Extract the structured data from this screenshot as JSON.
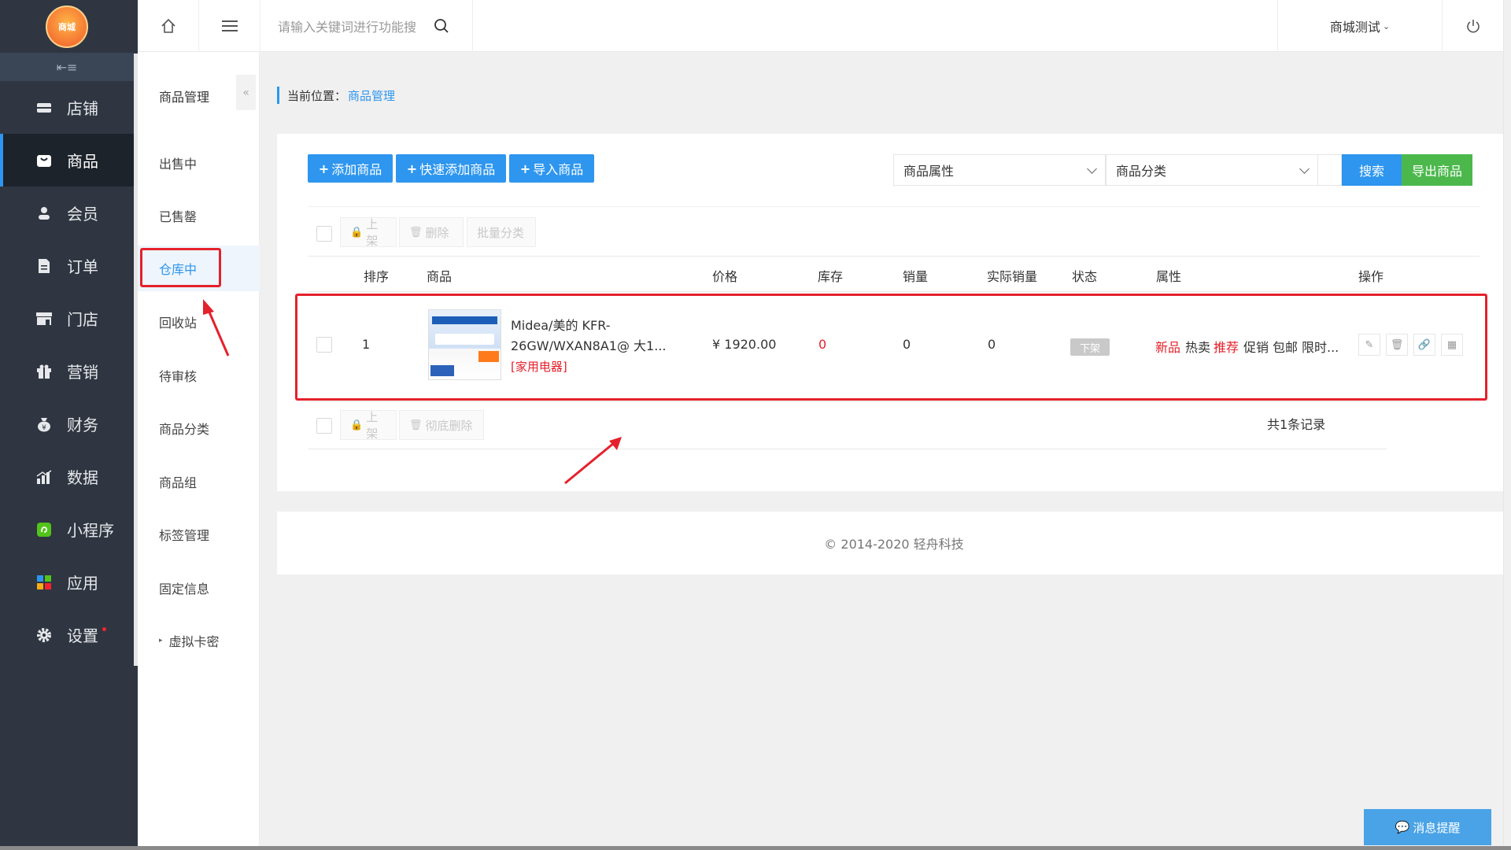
{
  "logo": {
    "label": "商城"
  },
  "sidebar": {
    "items": [
      {
        "label": "店铺",
        "icon": "store-icon"
      },
      {
        "label": "商品",
        "icon": "goods-icon",
        "active": true
      },
      {
        "label": "会员",
        "icon": "member-icon"
      },
      {
        "label": "订单",
        "icon": "order-icon"
      },
      {
        "label": "门店",
        "icon": "shop-icon"
      },
      {
        "label": "营销",
        "icon": "gift-icon"
      },
      {
        "label": "财务",
        "icon": "money-bag-icon"
      },
      {
        "label": "数据",
        "icon": "chart-icon"
      },
      {
        "label": "小程序",
        "icon": "miniprogram-icon"
      },
      {
        "label": "应用",
        "icon": "apps-icon"
      },
      {
        "label": "设置",
        "icon": "gear-icon"
      }
    ]
  },
  "subnav": {
    "title": "商品管理",
    "items": [
      {
        "label": "出售中"
      },
      {
        "label": "已售罄"
      },
      {
        "label": "仓库中",
        "active": true
      },
      {
        "label": "回收站"
      },
      {
        "label": "待审核"
      },
      {
        "label": "商品分类"
      },
      {
        "label": "商品组"
      },
      {
        "label": "标签管理"
      },
      {
        "label": "固定信息"
      },
      {
        "label": "虚拟卡密"
      }
    ]
  },
  "topbar": {
    "search_placeholder": "请输入关键词进行功能搜",
    "store_name": "商城测试"
  },
  "breadcrumb": {
    "prefix": "当前位置：",
    "current": "商品管理"
  },
  "toolbar": {
    "add": "添加商品",
    "quick_add": "快速添加商品",
    "import": "导入商品",
    "attr_select": "商品属性",
    "category_select": "商品分类",
    "search": "搜索",
    "export": "导出商品"
  },
  "bulk": {
    "shelf_on": "上架",
    "delete": "删除",
    "batch_category": "批量分类",
    "delete_perm": "彻底删除"
  },
  "table": {
    "headers": [
      "排序",
      "商品",
      "价格",
      "库存",
      "销量",
      "实际销量",
      "状态",
      "属性",
      "操作"
    ],
    "rows": [
      {
        "sort": "1",
        "name_line1": "Midea/美的 KFR-",
        "name_line2": "26GW/WXAN8A1@ 大1...",
        "category": "[家用电器]",
        "price": "¥ 1920.00",
        "stock": "0",
        "sales": "0",
        "actual_sales": "0",
        "status": "下架",
        "attrs": [
          {
            "text": "新品",
            "color": "#e5212b"
          },
          {
            "text": "热卖",
            "color": "#333333"
          },
          {
            "text": "推荐",
            "color": "#e5212b"
          },
          {
            "text": "促销",
            "color": "#333333"
          },
          {
            "text": "包邮",
            "color": "#333333"
          },
          {
            "text": "限时...",
            "color": "#333333"
          }
        ]
      }
    ],
    "total": "共1条记录"
  },
  "footer": {
    "copyright": "© 2014-2020 轻舟科技"
  },
  "message_button": "消息提醒",
  "colors": {
    "primary": "#2e96ee",
    "success": "#4cb84c",
    "danger": "#e5212b",
    "sidebar": "#2f3641"
  }
}
